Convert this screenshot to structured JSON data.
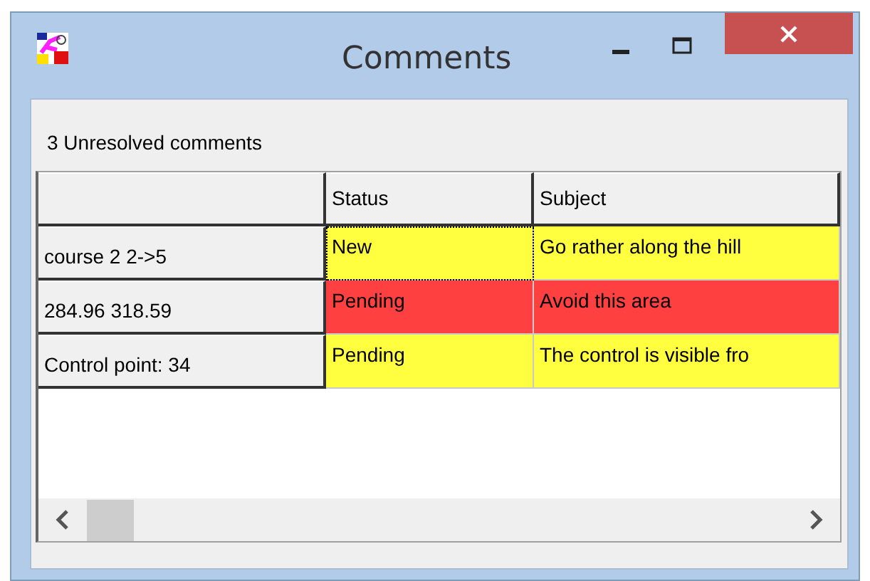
{
  "window": {
    "title": "Comments"
  },
  "summary": "3 Unresolved comments",
  "table": {
    "columns": [
      "",
      "Status",
      "Subject"
    ],
    "rows": [
      {
        "header": "course 2 2->5",
        "status": "New",
        "subject": "Go rather along the hill",
        "color": "#ffff40",
        "focused": true
      },
      {
        "header": "284.96 318.59",
        "status": "Pending",
        "subject": "Avoid this area",
        "color": "#ff4040",
        "focused": false
      },
      {
        "header": "Control point: 34",
        "status": "Pending",
        "subject": "The control is visible fro",
        "color": "#ffff40",
        "focused": false
      }
    ]
  }
}
